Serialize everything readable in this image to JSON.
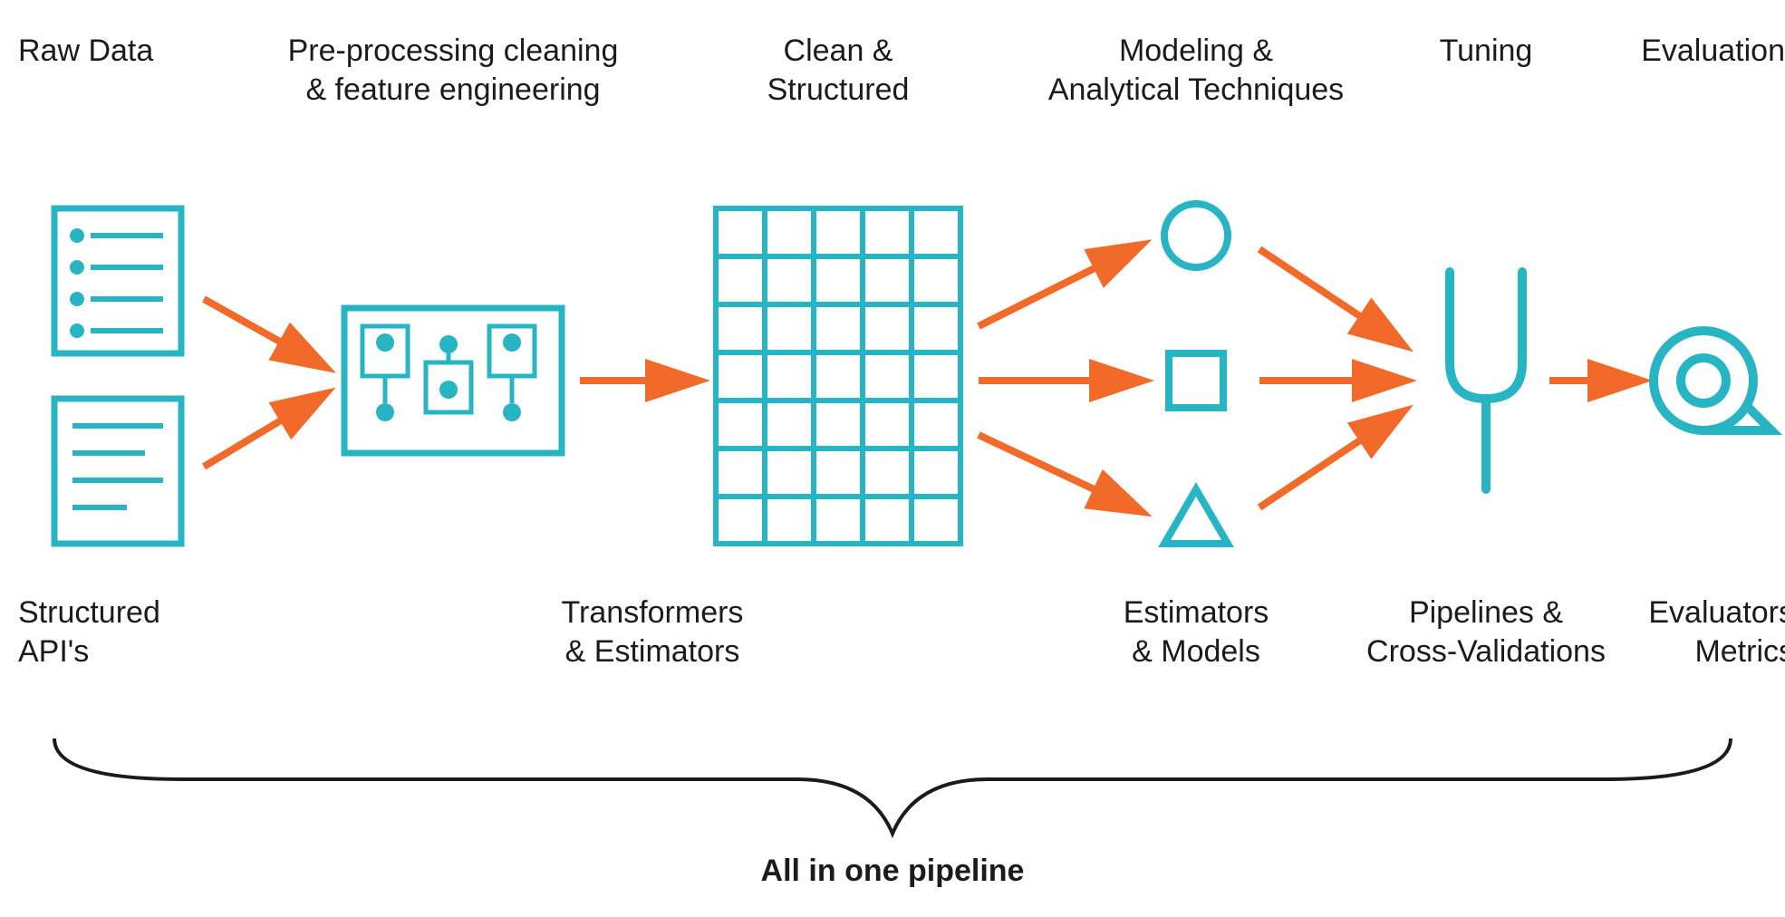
{
  "colors": {
    "teal": "#27b5c4",
    "orange": "#f26a2a",
    "black": "#1b1b1b"
  },
  "stages": [
    {
      "id": "raw-data",
      "top": "Raw Data",
      "bottom": "Structured\nAPI's"
    },
    {
      "id": "preproc",
      "top": "Pre-processing cleaning\n& feature engineering",
      "bottom": "Transformers\n& Estimators"
    },
    {
      "id": "clean",
      "top": "Clean &\nStructured",
      "bottom": ""
    },
    {
      "id": "modeling",
      "top": "Modeling &\nAnalytical Techniques",
      "bottom": "Estimators\n& Models"
    },
    {
      "id": "tuning",
      "top": "Tuning",
      "bottom": "Pipelines &\nCross-Validations"
    },
    {
      "id": "eval",
      "top": "Evaluation",
      "bottom": "Evaluators\nMetrics"
    }
  ],
  "brace_caption": "All in one pipeline"
}
